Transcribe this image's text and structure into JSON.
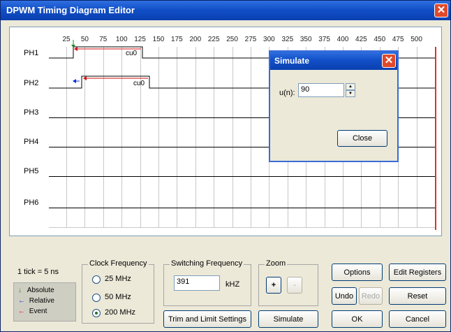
{
  "window": {
    "title": "DPWM Timing Diagram Editor",
    "close_glyph": "✕"
  },
  "diagram": {
    "ticks": [
      "25",
      "50",
      "75",
      "100",
      "125",
      "150",
      "175",
      "200",
      "225",
      "250",
      "275",
      "300",
      "325",
      "350",
      "375",
      "400",
      "425",
      "450",
      "475",
      "500"
    ],
    "phases": [
      "PH1",
      "PH2",
      "PH3",
      "PH4",
      "PH5",
      "PH6"
    ],
    "ph1_event_label": "cu0",
    "ph2_event_label": "cu0"
  },
  "simulate_dialog": {
    "title": "Simulate",
    "un_label": "u(n):",
    "un_value": "90",
    "close_label": "Close"
  },
  "tick_info": "1 tick = 5 ns",
  "legend": {
    "absolute": "Absolute",
    "relative": "Relative",
    "event": "Event"
  },
  "clock_frequency": {
    "label": "Clock Frequency",
    "options": [
      "25 MHz",
      "50 MHz",
      "200 MHz"
    ],
    "selected": "200 MHz"
  },
  "switching_frequency": {
    "label": "Switching Frequency",
    "value": "391",
    "unit": "kHZ"
  },
  "zoom": {
    "label": "Zoom",
    "in": "+",
    "out": "-"
  },
  "buttons": {
    "trim": "Trim and Limit Settings",
    "simulate": "Simulate",
    "options": "Options",
    "edit_registers": "Edit Registers",
    "undo": "Undo",
    "redo": "Redo",
    "reset": "Reset",
    "ok": "OK",
    "cancel": "Cancel"
  },
  "colors": {
    "absolute": "#1a8a1a",
    "relative": "#1030d0",
    "event": "#d01010",
    "titlebar": "#1250c8"
  }
}
